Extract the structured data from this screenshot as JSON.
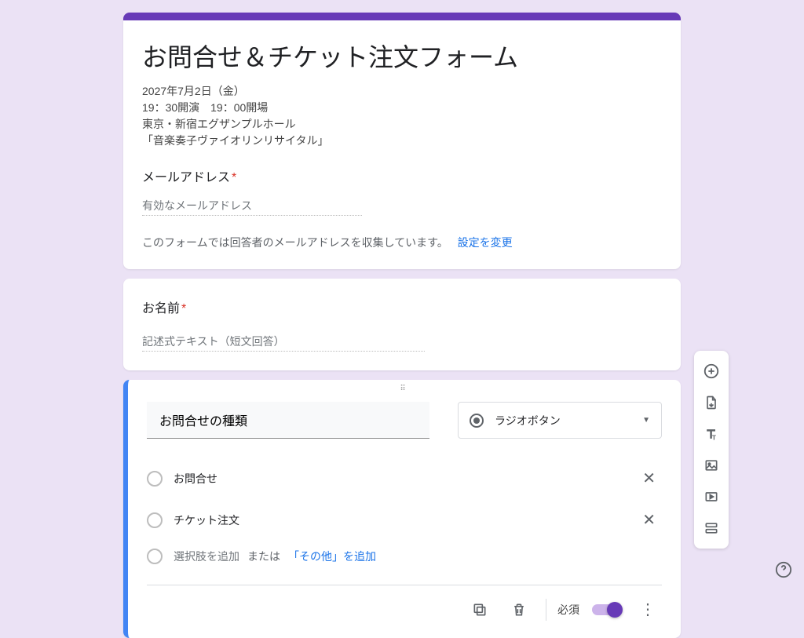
{
  "header": {
    "title": "お問合せ＆チケット注文フォーム",
    "desc_lines": [
      "2027年7月2日（金）",
      "19：30開演　19：00開場",
      "東京・新宿エグザンプルホール",
      "「音楽奏子ヴァイオリンリサイタル」"
    ],
    "email_label": "メールアドレス",
    "email_placeholder": "有効なメールアドレス",
    "collect_note": "このフォームでは回答者のメールアドレスを収集しています。",
    "change_settings": "設定を変更"
  },
  "q_name": {
    "title": "お名前",
    "placeholder": "記述式テキスト（短文回答）"
  },
  "q_active": {
    "title": "お問合せの種類",
    "type_label": "ラジオボタン",
    "options": [
      "お問合せ",
      "チケット注文"
    ],
    "add_option": "選択肢を追加",
    "or_text": "または",
    "add_other": "「その他」を追加",
    "required_label": "必須"
  }
}
